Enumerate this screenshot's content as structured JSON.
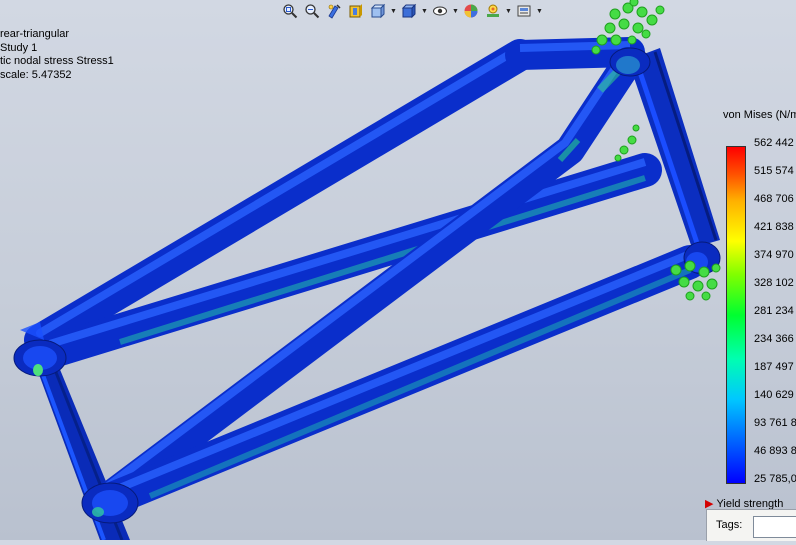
{
  "toolbar": {
    "buttons": [
      {
        "icon": "zoom-to-fit-icon",
        "dropdown": false
      },
      {
        "icon": "zoom-to-area-icon",
        "dropdown": false
      },
      {
        "icon": "previous-view-icon",
        "dropdown": false
      },
      {
        "icon": "section-view-icon",
        "dropdown": false
      },
      {
        "icon": "view-orientation-icon",
        "dropdown": true
      },
      {
        "icon": "display-style-icon",
        "dropdown": true
      },
      {
        "icon": "hide-show-items-icon",
        "dropdown": true
      },
      {
        "icon": "edit-appearance-icon",
        "dropdown": false
      },
      {
        "icon": "apply-scene-icon",
        "dropdown": true
      },
      {
        "icon": "view-settings-icon",
        "dropdown": true
      }
    ]
  },
  "info": {
    "model_name": "rear-triangular",
    "study_name": "Study 1",
    "plot_type": "tic nodal stress Stress1",
    "deformation_scale": "scale: 5.47352"
  },
  "legend": {
    "title": "von Mises (N/m",
    "ticks": [
      "562 442",
      "515 574",
      "468 706",
      "421 838",
      "374 970",
      "328 102",
      "281 234",
      "234 366",
      "187 497",
      "140 629",
      "93 761 8",
      "46 893 8",
      "25 785,0"
    ],
    "yield_label": "Yield strength"
  },
  "colors": {
    "background": "#c9d0dc",
    "low_stress": "#0030e0",
    "high_stress": "#ff0000",
    "fixture": "#2ec82e"
  },
  "tags": {
    "label": "Tags:",
    "value": ""
  }
}
